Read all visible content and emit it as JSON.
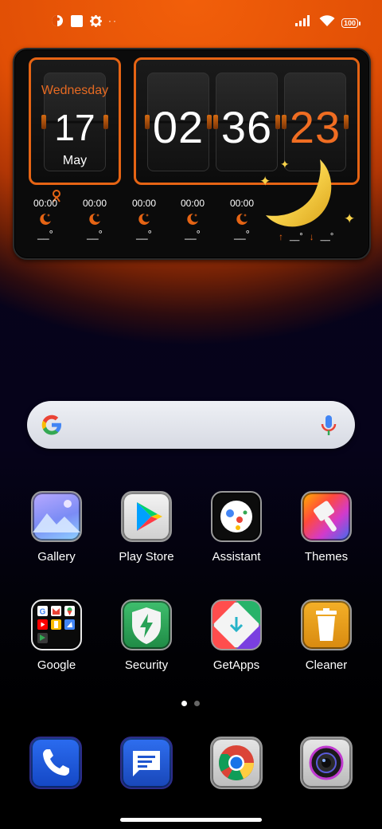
{
  "status_bar": {
    "left_icons": [
      "weather-status-icon",
      "square-notification-icon",
      "settings-gear-icon",
      "more-dots-icon"
    ],
    "battery": "100"
  },
  "clock_widget": {
    "weekday": "Wednesday",
    "day": "17",
    "month": "May",
    "hours": "02",
    "minutes": "36",
    "seconds": "23",
    "forecast": [
      {
        "time": "00:00",
        "temp": "__°"
      },
      {
        "time": "00:00",
        "temp": "__°"
      },
      {
        "time": "00:00",
        "temp": "__°"
      },
      {
        "time": "00:00",
        "temp": "__°"
      },
      {
        "time": "00:00",
        "temp": "__°"
      }
    ],
    "high_low": {
      "high": "__°",
      "low": "__°"
    }
  },
  "search_bar": {
    "logo": "google-g-icon",
    "mic": "microphone-icon"
  },
  "apps": [
    {
      "label": "Gallery",
      "icon": "gallery-icon"
    },
    {
      "label": "Play Store",
      "icon": "play-store-icon"
    },
    {
      "label": "Assistant",
      "icon": "assistant-icon"
    },
    {
      "label": "Themes",
      "icon": "themes-icon"
    },
    {
      "label": "Google",
      "icon": "google-folder-icon"
    },
    {
      "label": "Security",
      "icon": "security-icon"
    },
    {
      "label": "GetApps",
      "icon": "getapps-icon"
    },
    {
      "label": "Cleaner",
      "icon": "cleaner-icon"
    }
  ],
  "dock": [
    {
      "icon": "phone-icon"
    },
    {
      "icon": "messages-icon"
    },
    {
      "icon": "chrome-icon"
    },
    {
      "icon": "camera-icon"
    }
  ],
  "page_indicator": {
    "pages": 2,
    "current": 1
  },
  "colors": {
    "accent": "#e66414",
    "seconds": "#f06d22",
    "moon": "#f8d24a"
  }
}
